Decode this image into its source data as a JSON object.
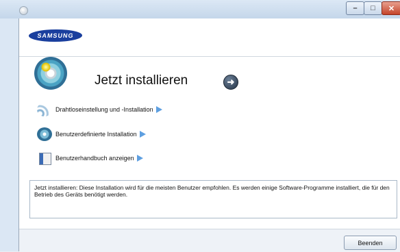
{
  "window": {
    "controls": {
      "minimize": "–",
      "maximize": "□",
      "close": "✕"
    }
  },
  "header": {
    "logo_text": "SAMSUNG"
  },
  "main": {
    "title": "Jetzt installieren",
    "arrow_icon": "arrow-right-circle-icon"
  },
  "menu": [
    {
      "label": "Drahtloseinstellung und -Installation",
      "icon": "wireless-icon"
    },
    {
      "label": "Benutzerdefinierte Installation",
      "icon": "custom-install-icon"
    },
    {
      "label": "Benutzerhandbuch anzeigen",
      "icon": "user-guide-icon"
    }
  ],
  "description": {
    "text": "Jetzt installieren: Diese Installation wird für die meisten Benutzer empfohlen. Es werden einige Software-Programme installiert, die für den Betrieb des Geräts benötigt werden."
  },
  "footer": {
    "finish_label": "Beenden"
  },
  "colors": {
    "brand": "#1a3f9e",
    "accent_arrow": "#5e9fe0"
  }
}
